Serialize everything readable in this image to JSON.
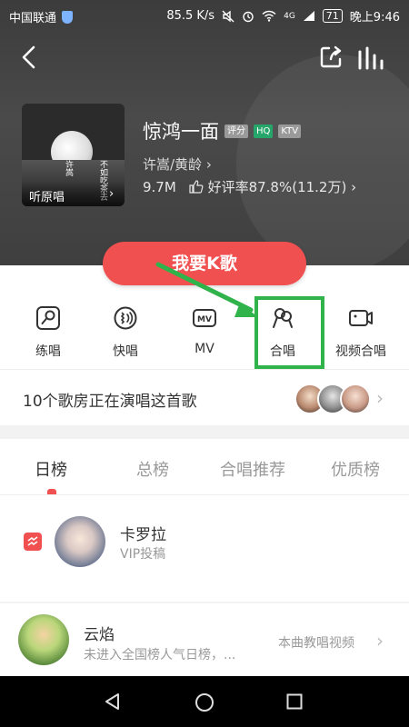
{
  "status_bar": {
    "carrier": "中国联通",
    "network_speed": "85.5 K/s",
    "network_type": "4G",
    "battery": "71",
    "time": "晚上9:46"
  },
  "song": {
    "title": "惊鸿一面",
    "badges": [
      "评分",
      "HQ",
      "KTV"
    ],
    "artists": "许嵩/黄龄",
    "plays": "9.7M",
    "rating": "好评率87.8%(11.2万)",
    "cover_label": "听原唱",
    "cover_text_left": "许嵩",
    "cover_text_right": "不如吃茶去"
  },
  "primary_button": "我要K歌",
  "actions": [
    {
      "label": "练唱",
      "icon": "mic-icon"
    },
    {
      "label": "快唱",
      "icon": "quick-sing-icon"
    },
    {
      "label": "MV",
      "icon": "mv-icon"
    },
    {
      "label": "合唱",
      "icon": "duet-icon"
    },
    {
      "label": "视频合唱",
      "icon": "video-duet-icon"
    }
  ],
  "rooms_banner": "10个歌房正在演唱这首歌",
  "tabs": [
    "日榜",
    "总榜",
    "合唱推荐",
    "优质榜"
  ],
  "list": [
    {
      "name": "卡罗拉",
      "subtitle": "VIP投稿"
    },
    {
      "name": "云焰",
      "subtitle": "未进入全国榜人气日榜，...",
      "link": "本曲教唱视频"
    }
  ],
  "colors": {
    "accent": "#f05050",
    "highlight": "#2fb34a",
    "hq_badge": "#26a66a"
  }
}
